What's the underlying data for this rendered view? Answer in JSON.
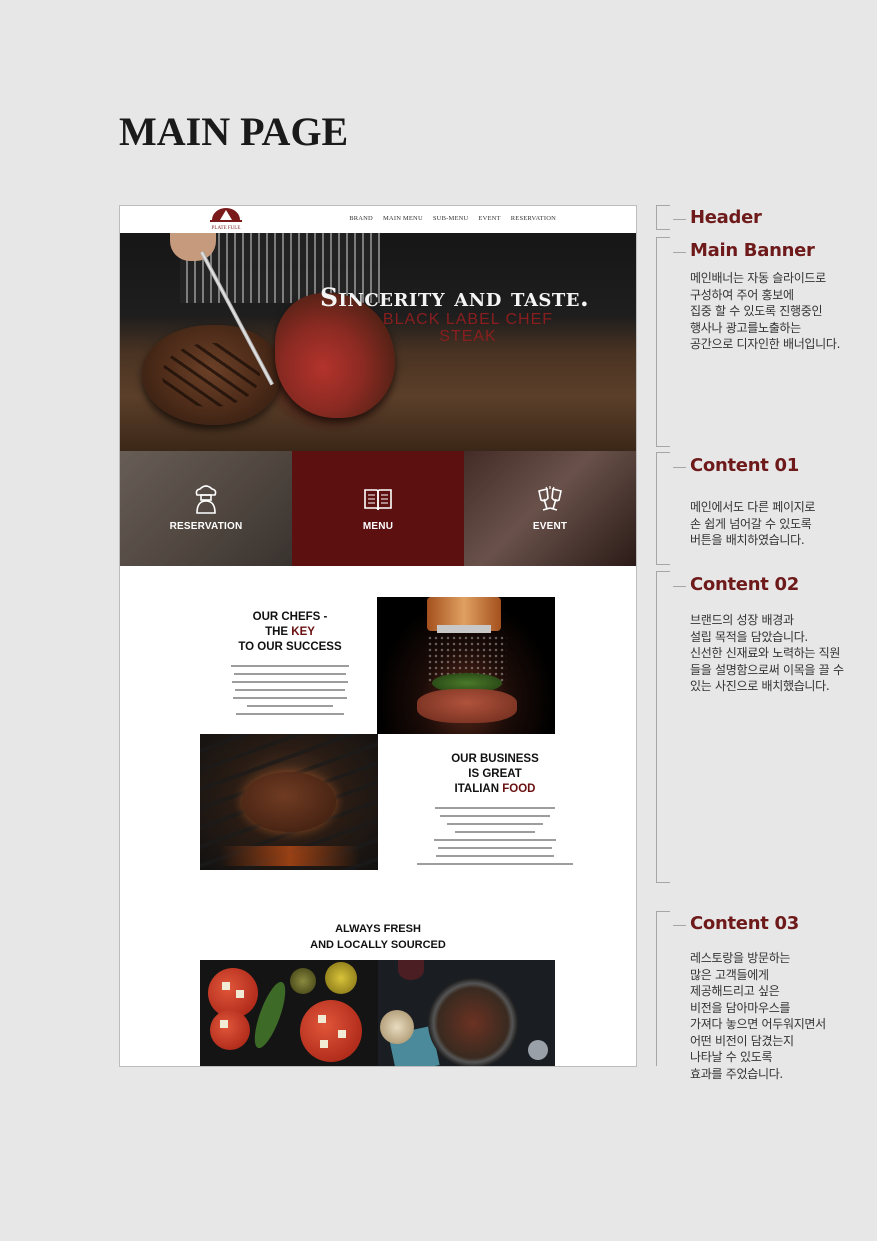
{
  "page": {
    "title": "MAIN PAGE"
  },
  "header": {
    "logo_text": "PLATE FULE",
    "nav": [
      "BRAND",
      "MAIN MENU",
      "SUB-MENU",
      "EVENT",
      "RESERVATION"
    ]
  },
  "banner": {
    "title": "Sincerity and taste.",
    "sub_line1": "BLACK LABEL CHEF",
    "sub_line2": "STEAK"
  },
  "quick_links": [
    {
      "label": "RESERVATION",
      "icon": "chef-icon"
    },
    {
      "label": "MENU",
      "icon": "book-icon"
    },
    {
      "label": "EVENT",
      "icon": "wine-glasses-icon"
    }
  ],
  "content02": {
    "block1": {
      "line1": "OUR CHEFS -",
      "line2_pre": "THE ",
      "line2_key": "KEY",
      "line3": "TO OUR SUCCESS"
    },
    "block2": {
      "line1": "OUR BUSINESS",
      "line2": "IS GREAT",
      "line3_pre": "ITALIAN ",
      "line3_key": "FOOD"
    }
  },
  "content03": {
    "line1": "ALWAYS FRESH",
    "line2": "AND LOCALLY SOURCED"
  },
  "annotations": [
    {
      "title": "Header",
      "desc": ""
    },
    {
      "title": "Main Banner",
      "desc": "메인배너는 자동 슬라이드로\n구성하여 주어 홍보에\n집중 할 수 있도록 진행중인\n행사나 광고를노출하는\n공간으로 디자인한 배너입니다."
    },
    {
      "title": "Content 01",
      "desc": "메인에서도 다른 페이지로\n손 쉽게 넘어갈 수 있도록\n버튼을 배치하였습니다."
    },
    {
      "title": "Content 02",
      "desc": "브랜드의  성장 배경과\n설립 목적을 담았습니다.\n신선한 신재료와 노력하는 직원\n들을 설명함으로써 이목을 끌 수\n있는 사진으로 배치했습니다."
    },
    {
      "title": "Content 03",
      "desc": "레스토랑을 방문하는\n많은 고객들에게\n제공해드리고 싶은\n비전을 담아마우스를\n가져다 놓으면 어두워지면서\n 어떤 비전이 담겼는지\n나타날 수 있도록\n효과를 주었습니다."
    }
  ],
  "colors": {
    "accent": "#6e1a1a",
    "menu_box": "#5c1010",
    "background": "#e7e7e7"
  }
}
